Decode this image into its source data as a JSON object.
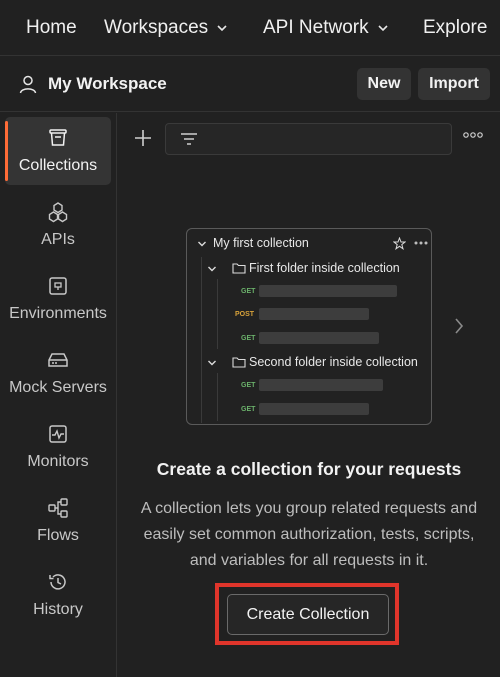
{
  "nav": {
    "home": "Home",
    "workspaces": "Workspaces",
    "api_network": "API Network",
    "explore": "Explore"
  },
  "workspace": {
    "title": "My Workspace",
    "new_label": "New",
    "import_label": "Import"
  },
  "sidebar": {
    "items": [
      {
        "label": "Collections",
        "icon": "collections-icon",
        "active": true
      },
      {
        "label": "APIs",
        "icon": "apis-icon"
      },
      {
        "label": "Environments",
        "icon": "environments-icon"
      },
      {
        "label": "Mock Servers",
        "icon": "mock-servers-icon"
      },
      {
        "label": "Monitors",
        "icon": "monitors-icon"
      },
      {
        "label": "Flows",
        "icon": "flows-icon"
      },
      {
        "label": "History",
        "icon": "history-icon"
      }
    ]
  },
  "preview": {
    "collection": "My first collection",
    "folder1": "First folder inside collection",
    "folder2": "Second folder inside collection",
    "methods": [
      "GET",
      "POST",
      "GET",
      "GET",
      "GET"
    ]
  },
  "empty_state": {
    "title": "Create a collection for your requests",
    "description": "A collection lets you group related requests and easily set common authorization, tests, scripts, and variables for all requests in it.",
    "button": "Create Collection"
  },
  "colors": {
    "background": "#212121",
    "active_accent": "#ff6c37",
    "highlight_box": "#e0352b",
    "get_method": "#6bb16b",
    "post_method": "#d9a33a"
  }
}
